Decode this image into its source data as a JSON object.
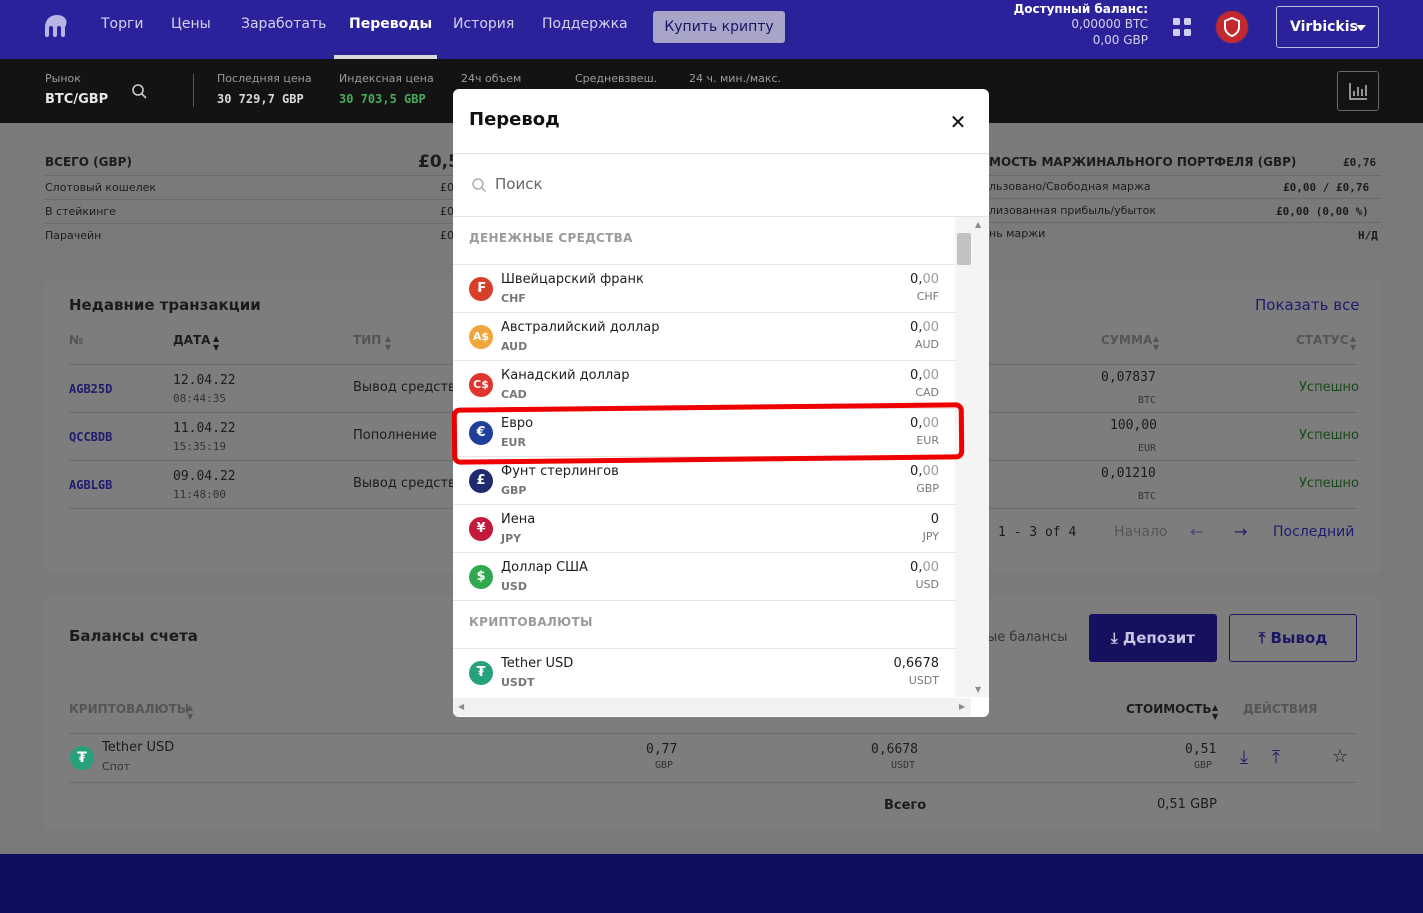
{
  "nav": {
    "items": [
      "Торги",
      "Цены",
      "Заработать",
      "Переводы",
      "История",
      "Поддержка"
    ],
    "active_index": 3,
    "buy_button": "Купить крипту",
    "balance_label": "Доступный баланс:",
    "balance_btc": "0,00000 BTC",
    "balance_gbp": "0,00 GBP",
    "user": "Virbickis"
  },
  "market": {
    "market_label": "Рынок",
    "pair": "BTC/GBP",
    "last_price_label": "Последняя цена",
    "last_price": "30 729,7 GBP",
    "index_price_label": "Индексная цена",
    "index_price": "30 703,5 GBP",
    "volume_label": "24ч объем",
    "vwap_label": "Средневзвеш.",
    "minmax_label": "24 ч. мин./макс."
  },
  "portfolio": {
    "total_label": "ВСЕГО (GBP)",
    "total_value": "£0,5",
    "spot_label": "Слотовый кошелек",
    "staking_label": "В стейкинге",
    "parachain_label": "Парачейн",
    "cut_value": "£0",
    "margin_label": "МОСТЬ МАРЖИНАЛЬНОГО ПОРТФЕЛЯ (GBP)",
    "margin_value": "£0,76",
    "used_label": "льзовано/Свободная маржа",
    "used_value": "£0,00 / £0,76",
    "pnl_label": "лизованная прибыль/убыток",
    "pnl_value": "£0,00 (0,00 %)",
    "level_label": "нь маржи",
    "level_value": "Н/Д"
  },
  "transactions": {
    "title": "Недавние транзакции",
    "show_all": "Показать все",
    "col_no": "№",
    "col_date": "ДАТА",
    "col_type": "ТИП",
    "col_amount": "СУММА",
    "col_status": "СТАТУС",
    "rows": [
      {
        "id": "AGB25D",
        "date": "12.04.22",
        "time": "08:44:35",
        "type": "Вывод средств",
        "amount": "0,07837",
        "unit": "BTC",
        "status": "Успешно"
      },
      {
        "id": "QCCBDB",
        "date": "11.04.22",
        "time": "15:35:19",
        "type": "Пополнение",
        "amount": "100,00",
        "unit": "EUR",
        "status": "Успешно"
      },
      {
        "id": "AGBLGB",
        "date": "09.04.22",
        "time": "11:48:00",
        "type": "Вывод средств",
        "amount": "0,01210",
        "unit": "BTC",
        "status": "Успешно"
      }
    ],
    "pagination": "1 - 3 of 4",
    "first": "Начало",
    "last": "Последний"
  },
  "balances": {
    "title": "Балансы счета",
    "hide_small": "ые балансы",
    "deposit": "Депозит",
    "withdraw": "Вывод",
    "col_crypto": "КРИПТОВАЛЮТЫ",
    "col_value": "СТОИМОСТЬ",
    "col_actions": "ДЕЙСТВИЯ",
    "row": {
      "name": "Tether USD",
      "sub": "Спот",
      "gbp": "0,77",
      "gbp_unit": "GBP",
      "amount": "0,6678",
      "amount_unit": "USDT",
      "value": "0,51",
      "value_unit": "GBP"
    },
    "total_label": "Всего",
    "total_value": "0,51 GBP"
  },
  "modal": {
    "title": "Перевод",
    "search_placeholder": "Поиск",
    "section_fiat": "ДЕНЕЖНЫЕ СРЕДСТВА",
    "section_crypto": "КРИПТОВАЛЮТЫ",
    "fiat": [
      {
        "name": "Швейцарский франк",
        "code": "CHF",
        "int": "0,",
        "dec": "00",
        "unit": "CHF",
        "symbol": "₣",
        "color": "#d6402b"
      },
      {
        "name": "Австралийский доллар",
        "code": "AUD",
        "int": "0,",
        "dec": "00",
        "unit": "AUD",
        "symbol": "A$",
        "color": "#f0a63a"
      },
      {
        "name": "Канадский доллар",
        "code": "CAD",
        "int": "0,",
        "dec": "00",
        "unit": "CAD",
        "symbol": "C$",
        "color": "#e0342d"
      },
      {
        "name": "Евро",
        "code": "EUR",
        "int": "0,",
        "dec": "00",
        "unit": "EUR",
        "symbol": "€",
        "color": "#1f3f9a"
      },
      {
        "name": "Фунт стерлингов",
        "code": "GBP",
        "int": "0,",
        "dec": "00",
        "unit": "GBP",
        "symbol": "£",
        "color": "#1f2b6e"
      },
      {
        "name": "Иена",
        "code": "JPY",
        "int": "0",
        "dec": "",
        "unit": "JPY",
        "symbol": "¥",
        "color": "#c4183c"
      },
      {
        "name": "Доллар США",
        "code": "USD",
        "int": "0,",
        "dec": "00",
        "unit": "USD",
        "symbol": "$",
        "color": "#2fa84f"
      }
    ],
    "crypto": [
      {
        "name": "Tether USD",
        "code": "USDT",
        "int": "0,6678",
        "dec": "",
        "unit": "USDT",
        "symbol": "₮",
        "color": "#26a17b"
      }
    ]
  }
}
